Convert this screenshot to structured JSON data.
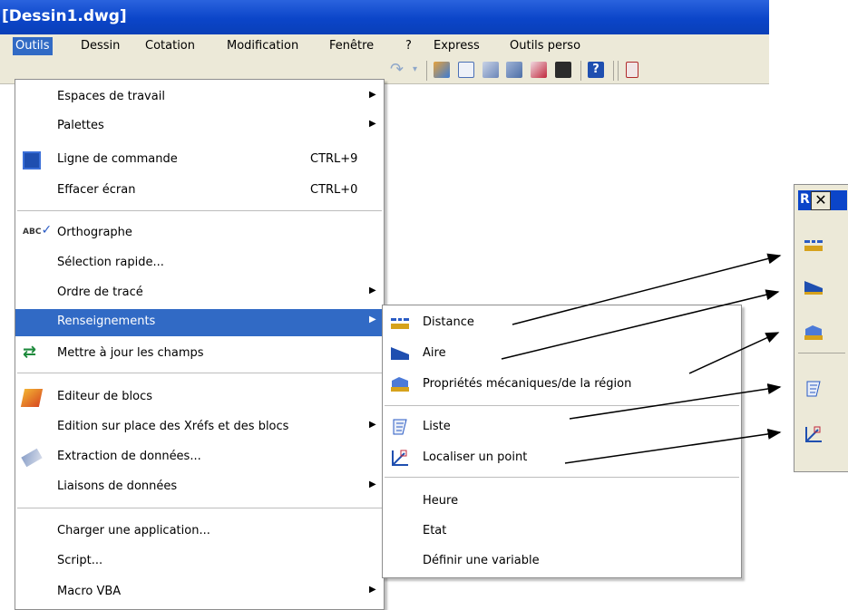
{
  "window": {
    "title": "[Dessin1.dwg]"
  },
  "menubar": {
    "items": [
      "Outils",
      "Dessin",
      "Cotation",
      "Modification",
      "Fenêtre",
      "?",
      "Express",
      "Outils perso"
    ]
  },
  "outils_menu": {
    "items": [
      {
        "label": "Espaces de travail",
        "shortcut": "",
        "submenu": true,
        "icon": ""
      },
      {
        "label": "Palettes",
        "shortcut": "",
        "submenu": true,
        "icon": ""
      },
      {
        "label": "Ligne de commande",
        "shortcut": "CTRL+9",
        "submenu": false,
        "icon": "command-line-icon"
      },
      {
        "label": "Effacer écran",
        "shortcut": "CTRL+0",
        "submenu": false,
        "icon": ""
      },
      {
        "label": "Orthographe",
        "shortcut": "",
        "submenu": false,
        "icon": "spell-check-icon"
      },
      {
        "label": "Sélection rapide...",
        "shortcut": "",
        "submenu": false,
        "icon": ""
      },
      {
        "label": "Ordre de tracé",
        "shortcut": "",
        "submenu": true,
        "icon": ""
      },
      {
        "label": "Renseignements",
        "shortcut": "",
        "submenu": true,
        "icon": ""
      },
      {
        "label": "Mettre à jour les champs",
        "shortcut": "",
        "submenu": false,
        "icon": "update-fields-icon"
      },
      {
        "label": "Editeur de blocs",
        "shortcut": "",
        "submenu": false,
        "icon": "block-editor-icon"
      },
      {
        "label": "Edition sur place des Xréfs et des blocs",
        "shortcut": "",
        "submenu": true,
        "icon": ""
      },
      {
        "label": "Extraction de données...",
        "shortcut": "",
        "submenu": false,
        "icon": "data-extraction-icon"
      },
      {
        "label": "Liaisons de données",
        "shortcut": "",
        "submenu": true,
        "icon": ""
      },
      {
        "label": "Charger une application...",
        "shortcut": "",
        "submenu": false,
        "icon": ""
      },
      {
        "label": "Script...",
        "shortcut": "",
        "submenu": false,
        "icon": ""
      },
      {
        "label": "Macro VBA",
        "shortcut": "",
        "submenu": true,
        "icon": ""
      }
    ]
  },
  "renseignements_submenu": {
    "items": [
      {
        "label": "Distance",
        "icon": "distance-icon"
      },
      {
        "label": "Aire",
        "icon": "area-icon"
      },
      {
        "label": "Propriétés mécaniques/de la région",
        "icon": "mass-properties-icon"
      },
      {
        "label": "Liste",
        "icon": "list-icon"
      },
      {
        "label": "Localiser un point",
        "icon": "locate-point-icon"
      },
      {
        "label": "Heure",
        "icon": ""
      },
      {
        "label": "Etat",
        "icon": ""
      },
      {
        "label": "Définir une variable",
        "icon": ""
      }
    ]
  },
  "floating_toolbar": {
    "title_glyph": "R",
    "close_glyph": "✕"
  }
}
